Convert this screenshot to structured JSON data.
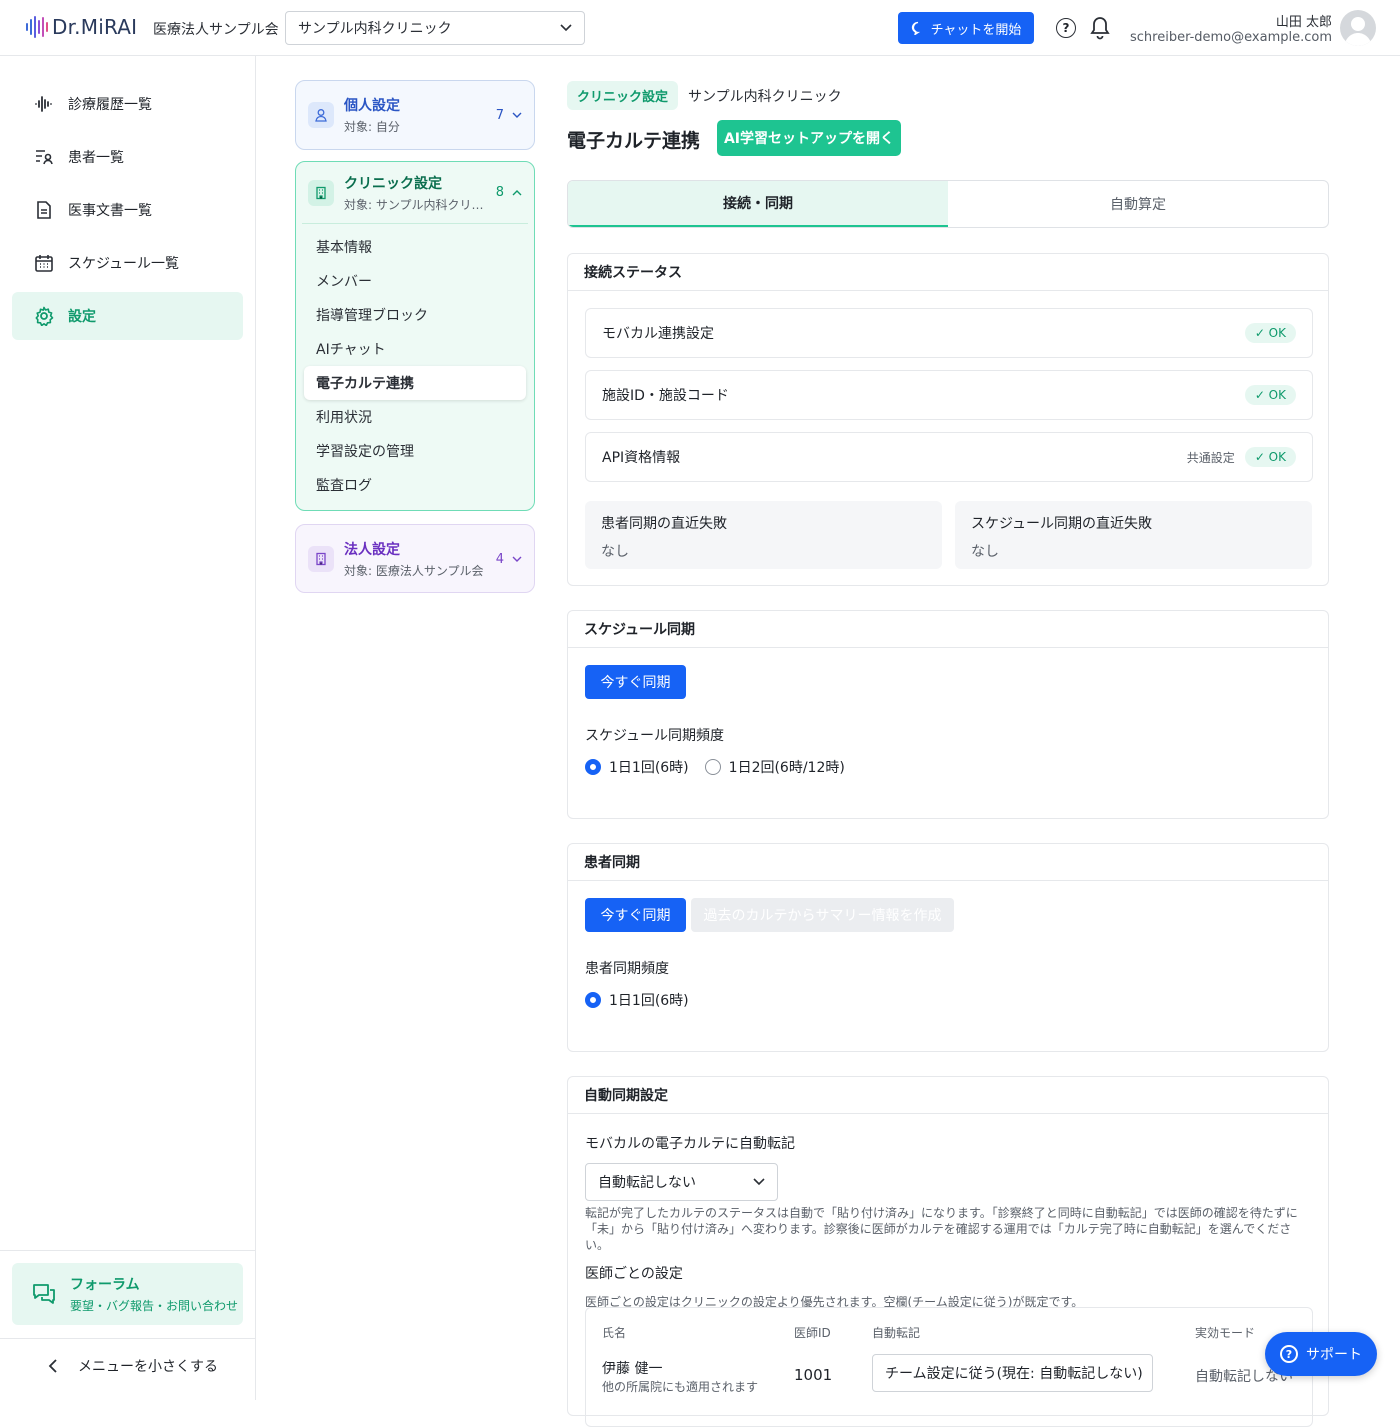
{
  "header": {
    "logo_text": "Dr.MiRAI",
    "org_name": "医療法人サンプル会",
    "clinic_select": "サンプル内科クリニック",
    "chat_button": "チャットを開始",
    "help_label": "?",
    "user_name": "山田 太郎",
    "user_email": "schreiber-demo@example.com"
  },
  "sidebar": {
    "items": [
      {
        "label": "診療履歴一覧",
        "icon": "waveform-icon"
      },
      {
        "label": "患者一覧",
        "icon": "patient-list-icon"
      },
      {
        "label": "医事文書一覧",
        "icon": "document-icon"
      },
      {
        "label": "スケジュール一覧",
        "icon": "calendar-icon"
      },
      {
        "label": "設定",
        "icon": "gear-icon"
      }
    ],
    "forum_title": "フォーラム",
    "forum_sub": "要望・バグ報告・お問い合わせ",
    "collapse_label": "メニューを小さくする"
  },
  "settings_nav": {
    "personal": {
      "title": "個人設定",
      "sub": "対象: 自分",
      "count": "7"
    },
    "clinic": {
      "title": "クリニック設定",
      "sub": "対象: サンプル内科クリニック",
      "count": "8",
      "items": [
        "基本情報",
        "メンバー",
        "指導管理ブロック",
        "AIチャット",
        "電子カルテ連携",
        "利用状況",
        "学習設定の管理",
        "監査ログ"
      ]
    },
    "corp": {
      "title": "法人設定",
      "sub": "対象: 医療法人サンプル会",
      "count": "4"
    }
  },
  "main": {
    "breadcrumb_badge": "クリニック設定",
    "breadcrumb_name": "サンプル内科クリニック",
    "title": "電子カルテ連携",
    "ai_button": "AI学習セットアップを開く",
    "tabs": [
      "接続・同期",
      "自動算定"
    ],
    "connection": {
      "title": "接続ステータス",
      "rows": [
        {
          "label": "モバカル連携設定",
          "status": "✓ OK",
          "note": ""
        },
        {
          "label": "施設ID・施設コード",
          "status": "✓ OK",
          "note": ""
        },
        {
          "label": "API資格情報",
          "status": "✓ OK",
          "note": "共通設定"
        }
      ],
      "patient_fail_title": "患者同期の直近失敗",
      "patient_fail_value": "なし",
      "schedule_fail_title": "スケジュール同期の直近失敗",
      "schedule_fail_value": "なし"
    },
    "schedule_sync": {
      "title": "スケジュール同期",
      "sync_button": "今すぐ同期",
      "freq_label": "スケジュール同期頻度",
      "options": [
        "1日1回(6時)",
        "1日2回(6時/12時)"
      ]
    },
    "patient_sync": {
      "title": "患者同期",
      "sync_button": "今すぐ同期",
      "summary_button": "過去のカルテからサマリー情報を作成",
      "freq_label": "患者同期頻度",
      "options": [
        "1日1回(6時)"
      ]
    },
    "auto_sync": {
      "title": "自動同期設定",
      "transfer_label": "モバカルの電子カルテに自動転記",
      "transfer_value": "自動転記しない",
      "note": "転記が完了したカルテのステータスは自動で「貼り付け済み」になります。「診察終了と同時に自動転記」では医師の確認を待たずに「未」から「貼り付け済み」へ変わります。診察後に医師がカルテを確認する運用では「カルテ完了時に自動転記」を選んでください。",
      "doctor_label": "医師ごとの設定",
      "doctor_note": "医師ごとの設定はクリニックの設定より優先されます。空欄(チーム設定に従う)が既定です。",
      "columns": [
        "氏名",
        "医師ID",
        "自動転記",
        "実効モード"
      ],
      "rows": [
        {
          "name": "伊藤 健一",
          "sub": "他の所属院にも適用されます",
          "id": "1001",
          "mode": "チーム設定に従う(現在: 自動転記しない)",
          "effective": "自動転記しない"
        }
      ]
    }
  },
  "support_label": "サポート",
  "colors": {
    "accent": "#1ec491",
    "primary": "#1662f5",
    "accent_text": "#0f9a6c"
  }
}
